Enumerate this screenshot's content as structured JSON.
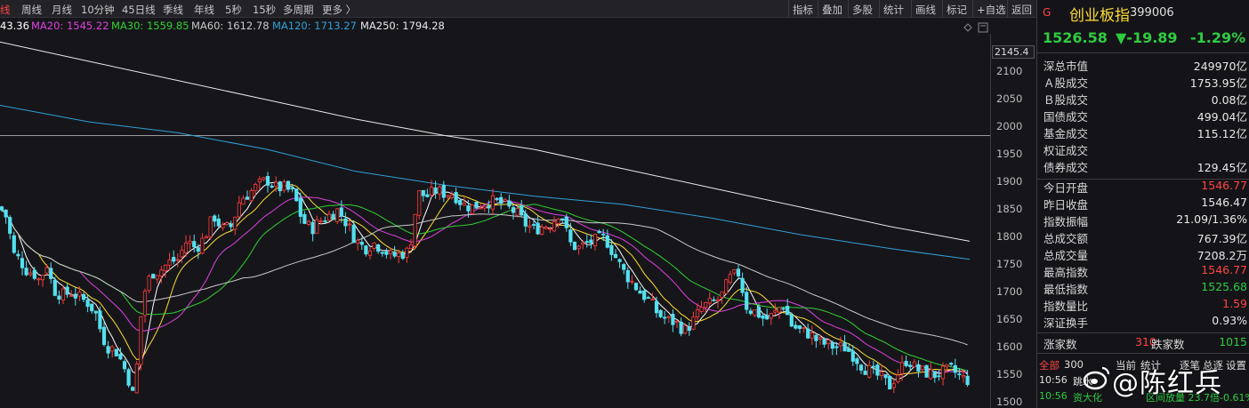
{
  "toolbar": {
    "periods": [
      "线",
      "周线",
      "月线",
      "10分钟",
      "45日线",
      "季线",
      "年线",
      "5秒",
      "15秒",
      "多周期",
      "更多 〉"
    ],
    "tools": [
      "指标",
      "叠加",
      "多股",
      "统计",
      "画线",
      "标记",
      "+自选",
      "返回"
    ]
  },
  "ma_legend": [
    {
      "text": "43.36",
      "color": "#ffffff"
    },
    {
      "text": "MA20: 1545.22",
      "color": "#e040e0"
    },
    {
      "text": "MA30: 1559.85",
      "color": "#30d030"
    },
    {
      "text": "MA60: 1612.78",
      "color": "#c8c8c8"
    },
    {
      "text": "MA120: 1713.27",
      "color": "#2fa0d8"
    },
    {
      "text": "MA250: 1794.28",
      "color": "#e8e8e8"
    }
  ],
  "y_axis": {
    "max_label": "2145.4",
    "ticks": [
      "2100",
      "2050",
      "2000",
      "1950",
      "1900",
      "1850",
      "1800",
      "1750",
      "1700",
      "1650",
      "1600",
      "1550",
      "1500"
    ],
    "tick_values": [
      2100,
      2050,
      2000,
      1950,
      1900,
      1850,
      1800,
      1750,
      1700,
      1650,
      1600,
      1550,
      1500
    ],
    "range": [
      1490,
      2170
    ],
    "reference_line": 1985
  },
  "colors": {
    "up": "#ff3b3b",
    "down": "#54e0f0",
    "green_text": "#2ecc40",
    "red_text": "#ff4444",
    "yellow": "#ffdd33",
    "ma5": "#ffffff",
    "ma10": "#ffdd33",
    "ma20": "#e040e0",
    "ma30": "#30d030",
    "ma60": "#c8c8c8",
    "ma120": "#2fa0d8",
    "ma250": "#e8e8e8"
  },
  "panel": {
    "flag": "G",
    "name": "创业板指",
    "code": "399006",
    "price": "1526.58",
    "change": "▼-19.89",
    "change_pct": "-1.29%",
    "rows": [
      {
        "label": "深总市值",
        "value": "249970亿",
        "color": "#e8e8e8"
      },
      {
        "label": "Ａ股成交",
        "value": "1753.95亿",
        "color": "#e8e8e8"
      },
      {
        "label": "Ｂ股成交",
        "value": "0.08亿",
        "color": "#e8e8e8"
      },
      {
        "label": "国债成交",
        "value": "499.04亿",
        "color": "#e8e8e8"
      },
      {
        "label": "基金成交",
        "value": "115.12亿",
        "color": "#e8e8e8"
      },
      {
        "label": "权证成交",
        "value": "",
        "color": "#e8e8e8"
      },
      {
        "label": "债券成交",
        "value": "129.45亿",
        "color": "#e8e8e8"
      },
      {
        "label": "今日开盘",
        "value": "1546.77",
        "color": "#ff4444"
      },
      {
        "label": "昨日收盘",
        "value": "1546.47",
        "color": "#e8e8e8"
      },
      {
        "label": "指数振幅",
        "value": "21.09/1.36%",
        "color": "#e8e8e8"
      },
      {
        "label": "总成交额",
        "value": "767.39亿",
        "color": "#e8e8e8"
      },
      {
        "label": "总成交量",
        "value": "7208.2万",
        "color": "#e8e8e8"
      },
      {
        "label": "最高指数",
        "value": "1546.77",
        "color": "#ff4444"
      },
      {
        "label": "最低指数",
        "value": "1525.68",
        "color": "#2ecc40"
      },
      {
        "label": "指数量比",
        "value": "1.59",
        "color": "#ff4444"
      },
      {
        "label": "深证换手",
        "value": "0.93%",
        "color": "#e8e8e8"
      }
    ],
    "up_label": "涨家数",
    "up_count": "310",
    "down_label": "跌家数",
    "down_count": "1015",
    "tabs": [
      "全部",
      "300",
      "当前",
      "统计",
      "逐笔",
      "总逐",
      "设置"
    ],
    "tick_rows": [
      {
        "time": "10:56",
        "text": "跳水",
        "extra": ""
      },
      {
        "time": "10:56",
        "text": "资大化",
        "extra": "区间放量 23.7倍-0.61%"
      }
    ]
  },
  "watermark": "@陈红兵"
}
